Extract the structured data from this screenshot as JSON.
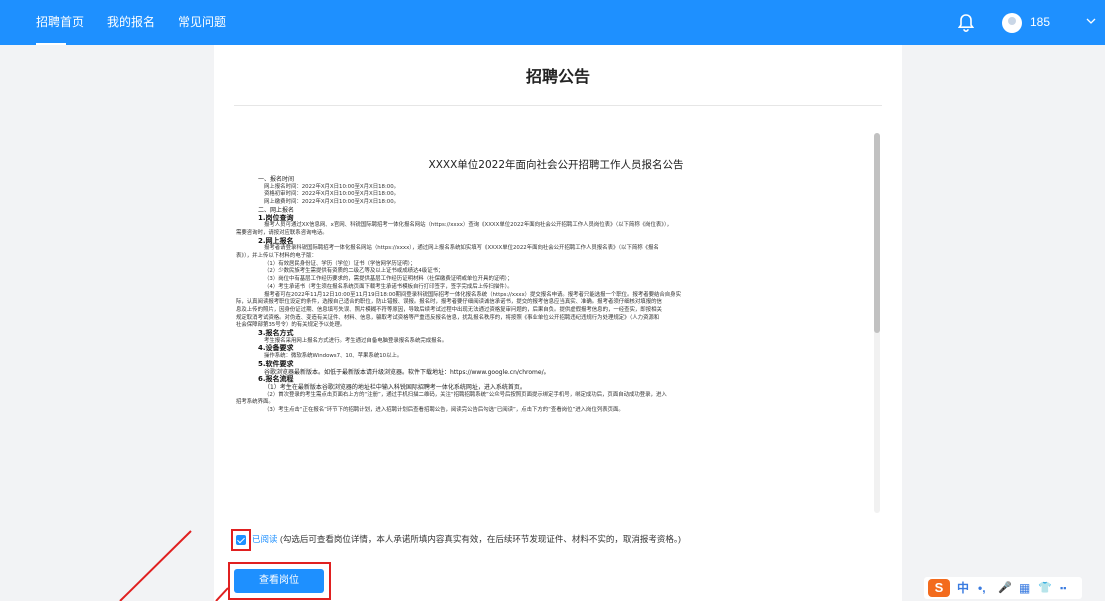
{
  "nav": {
    "items": [
      "招聘首页",
      "我的报名",
      "常见问题"
    ],
    "username": "185"
  },
  "page": {
    "title": "招聘公告"
  },
  "doc": {
    "title": "XXXX单位2022年面向社会公开招聘工作人员报名公告",
    "lines": [
      {
        "t": "一、报名时间",
        "c": "sub ind"
      },
      {
        "t": "网上报名时间：2022年X月X日10:00至X月X日18:00。",
        "c": "ind2"
      },
      {
        "t": "资格初审时间：2022年X月X日10:00至X月X日18:00。",
        "c": "ind2"
      },
      {
        "t": "网上缴费时间：2022年X月X日10:00至X月X日18:00。",
        "c": "ind2"
      },
      {
        "t": "二、网上报名",
        "c": "sub ind"
      },
      {
        "t": "1.岗位查询",
        "c": "head ind"
      },
      {
        "t": "报考人员可通过XX信息网、x官网、科锐国际聘招考一体化报名网站（https://xxxx）查询《XXXX单位2022年面向社会公开招聘工作人员岗位表》（以下简称《岗位表》），",
        "c": "ind2"
      },
      {
        "t": "需要咨询时，请按对应联系咨询电话。",
        "c": ""
      },
      {
        "t": "2.网上报名",
        "c": "head ind"
      },
      {
        "t": "报考者请登录科锐国际聘招考一体化报名网站（https://xxxx），通过网上报名系统如实填写《XXXX单位2022年面向社会公开招聘工作人员报名表》（以下简称《报名",
        "c": "ind2"
      },
      {
        "t": "表》），并上传以下材料的电子版：",
        "c": ""
      },
      {
        "t": "（1）有效居民身份证、学历（学位）证书（学信网学历证明）；",
        "c": "ind2"
      },
      {
        "t": "（2）少数民族考生需提供有资质的二级乙等及以上证书或成绩达4级证书；",
        "c": "ind2"
      },
      {
        "t": "（3）岗位中有基层工作经历要求的，需提供基层工作经历证明材料（社保缴费证明或单位开具的证明）；",
        "c": "ind2"
      },
      {
        "t": "（4）考生承诺书（考生须在报名系统页面下载考生承诺书模板自行打印签字，签字完成后上传扫描件）。",
        "c": "ind2"
      },
      {
        "t": "报考者可在2022年11月12日10:00至11月19日18:00期间登录科锐国际招考一体化报名系统（https://xxxx）提交报名申请。报考者只能选报一个职位。报考者要结合自身实",
        "c": "ind2"
      },
      {
        "t": "际，认真阅读报考职位设定的条件，选报自己适合的职位，防止错报、误报。报名时，报考者要仔细阅读诚信承诺书，提交的报考信息应当真实、准确。报考者须仔细核对填报的信",
        "c": ""
      },
      {
        "t": "息及上传的照片，因身份证过期、信息填写失误、照片模糊不符等原因，导致后续考试过程中出现无法通过资格复审问题的，后果自负。提供虚假报考信息的，一经查实，即按相关",
        "c": ""
      },
      {
        "t": "规定取消考试资格。对伪造、变造有关证件、材料、信息，骗取考试资格等严重违反报名信息，扰乱报名秩序的，将按照《事业单位公开招聘违纪违规行为处理规定》（人力资源和",
        "c": ""
      },
      {
        "t": "社会保障部第35号令）的有关规定予以处理。",
        "c": ""
      },
      {
        "t": "3.报名方式",
        "c": "head ind"
      },
      {
        "t": "考生报名采用网上报名方式进行。考生通过自备电脑登录报名系统完成报名。",
        "c": "ind2"
      },
      {
        "t": "4.设备要求",
        "c": "head ind"
      },
      {
        "t": "操作系统：微软系统Windows7、10、苹果系统10以上。",
        "c": "ind2"
      },
      {
        "t": "5.软件要求",
        "c": "head ind"
      },
      {
        "t": "谷歌浏览器最新版本。如低于最新版本请升级浏览器。软件下载地址：https://www.google.cn/chrome/。",
        "c": "ind2 sub"
      },
      {
        "t": "6.报名流程",
        "c": "head ind"
      },
      {
        "t": "（1）考生在最新版本谷歌浏览器的地址栏中输入科锐国际招聘考一体化系统网址，进入系统首页。",
        "c": "ind2 sub"
      },
      {
        "t": "（2）首次登录的考生需点击页面右上方的“注册”，通过手机扫描二维码，关注“招聘招聘系统”公众号后按照页面提示绑定手机号，绑定成功后，页面自动成功登录，进入",
        "c": "ind2"
      },
      {
        "t": "招考系统界面。",
        "c": ""
      },
      {
        "t": "（3）考生点击“正在报名”环节下的招聘计划，进入招聘计划后查看招聘公告，阅读完公告后勾选“已阅读”，点击下方的“查看岗位”进入岗位列表页面。",
        "c": "ind2"
      }
    ]
  },
  "agreement": {
    "link_label": "已阅读",
    "text": "(勾选后可查看岗位详情，本人承诺所填内容真实有效，在后续环节发现证件、材料不实的，取消报考资格。)"
  },
  "button": {
    "view_label": "查看岗位"
  },
  "ime": {
    "logo": "S",
    "items": [
      "中",
      "•,",
      "🎤",
      "▦",
      "👕",
      "▪▪"
    ]
  },
  "colors": {
    "primary": "#1e90ff",
    "highlight": "#e02020"
  }
}
